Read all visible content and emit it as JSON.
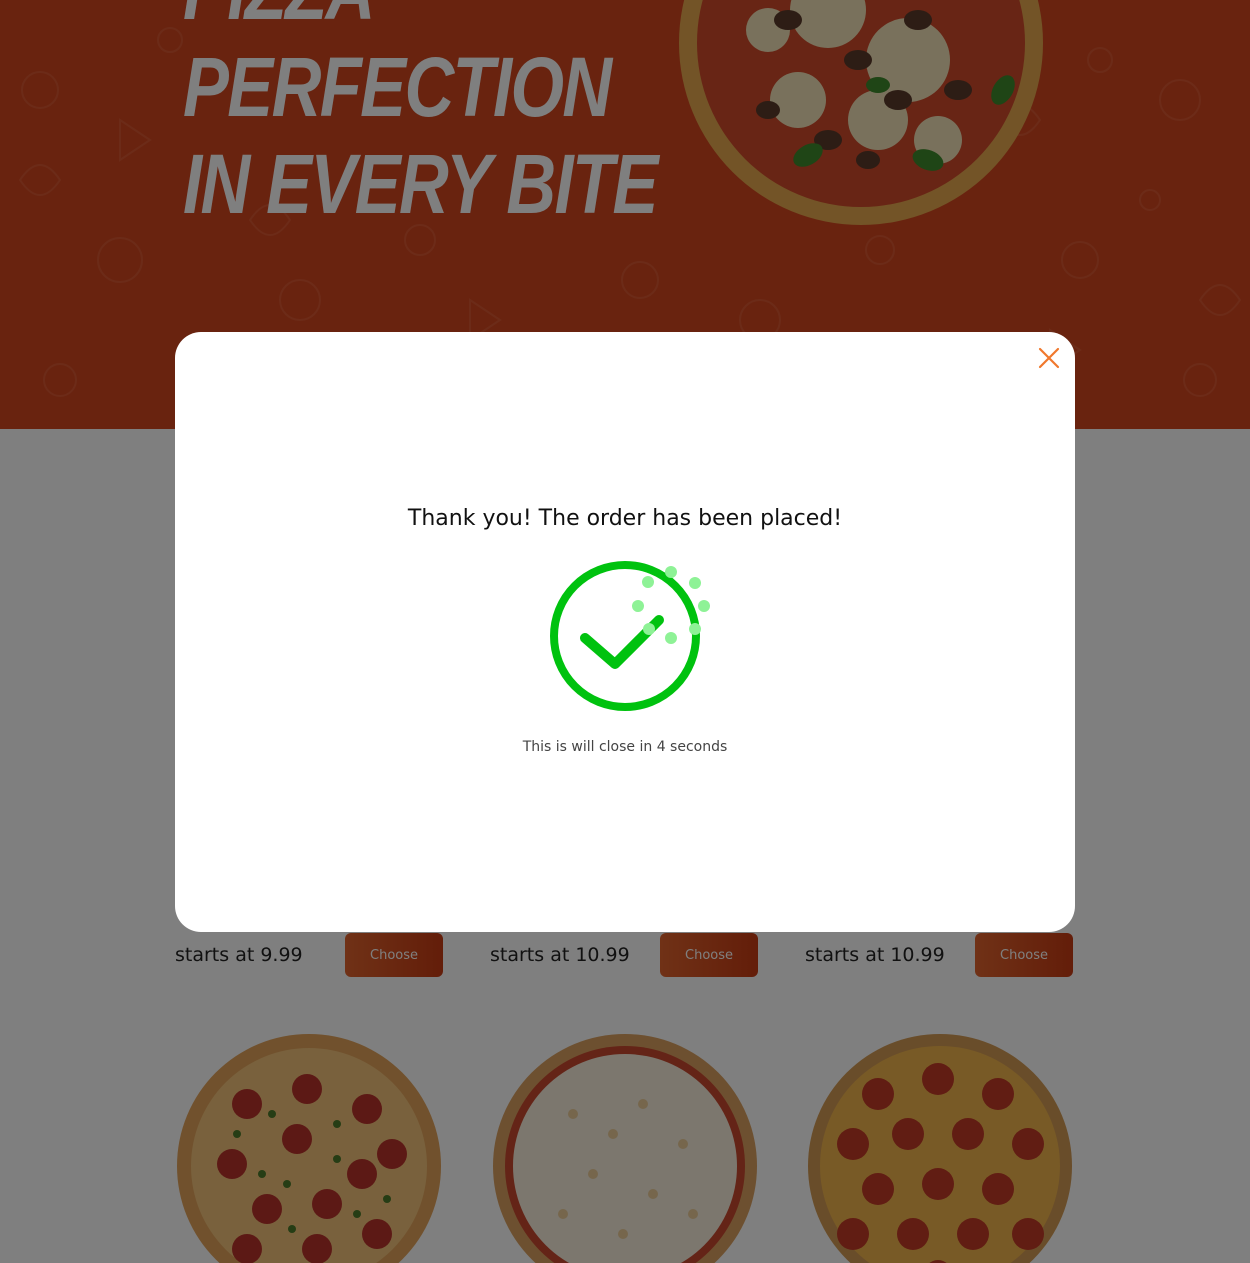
{
  "hero": {
    "title_lines": [
      "PIZZA",
      "PERFECTION",
      "IN EVERY BITE"
    ],
    "background_color": "#d2471f"
  },
  "menu": {
    "items": [
      {
        "price_text": "starts at 9.99",
        "button_label": "Choose",
        "pizza": "pepperoni-herb-pizza"
      },
      {
        "price_text": "starts at 10.99",
        "button_label": "Choose",
        "pizza": "cheese-pizza"
      },
      {
        "price_text": "starts at 10.99",
        "button_label": "Choose",
        "pizza": "pepperoni-pizza"
      }
    ]
  },
  "modal": {
    "title": "Thank you! The order has been placed!",
    "subtitle": "This is will close in 4 seconds",
    "close_icon": "close-icon",
    "success_icon": "check-circle-icon",
    "accent_color": "#00c20f",
    "close_color": "#f0782d"
  }
}
